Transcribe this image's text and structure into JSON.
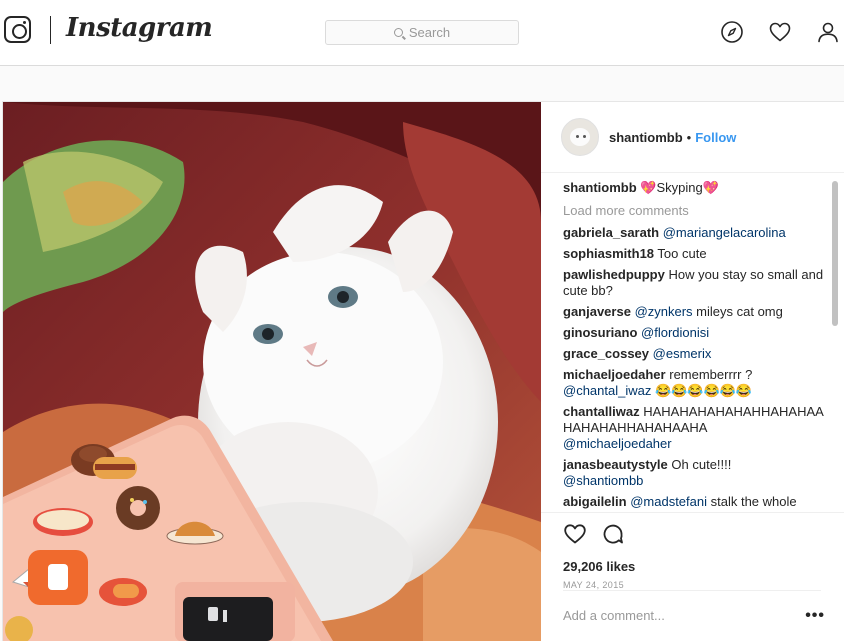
{
  "nav": {
    "brand": "Instagram",
    "search_placeholder": "Search",
    "icons": [
      "instagram-logo-icon",
      "compass-icon",
      "heart-icon",
      "profile-icon"
    ]
  },
  "post": {
    "owner": "shantiombb",
    "separator": "•",
    "follow_label": "Follow",
    "caption_user": "shantiombb",
    "caption_text": "💖Skyping💖",
    "load_more": "Load more comments",
    "comments": [
      {
        "user": "gabriela_sarath",
        "text": "",
        "mention": "@mariangelacarolina"
      },
      {
        "user": "sophiasmith18",
        "text": "Too cute",
        "mention": ""
      },
      {
        "user": "pawlishedpuppy",
        "text": "How you stay so small and cute bb?",
        "mention": ""
      },
      {
        "user": "ganjaverse",
        "text": "",
        "mention": "@zynkers",
        "after": " mileys cat omg"
      },
      {
        "user": "ginosuriano",
        "text": "",
        "mention": "@flordionisi"
      },
      {
        "user": "grace_cossey",
        "text": "",
        "mention": "@esmerix"
      },
      {
        "user": "michaeljoedaher",
        "text": "rememberrrr ?",
        "mention": "@chantal_iwaz",
        "after": " 😂😂😂😂😂😂"
      },
      {
        "user": "chantalliwaz",
        "text": "HAHAHAHAHAHAHHAHAHAAHAHAHAHHAHAHAAHA",
        "mention": "@michaeljoedaher"
      },
      {
        "user": "janasbeautystyle",
        "text": "Oh cute!!!!",
        "mention": "@shantiombb"
      },
      {
        "user": "abigailelin",
        "text": "",
        "mention": "@madstefani",
        "after": " stalk the whole"
      }
    ],
    "likes": "29,206 likes",
    "date": "MAY 24, 2015",
    "add_comment_placeholder": "Add a comment...",
    "more_label": "•••",
    "action_icons": [
      "heart-outline-icon",
      "comment-bubble-icon"
    ],
    "follow_color": "#3897f0"
  }
}
